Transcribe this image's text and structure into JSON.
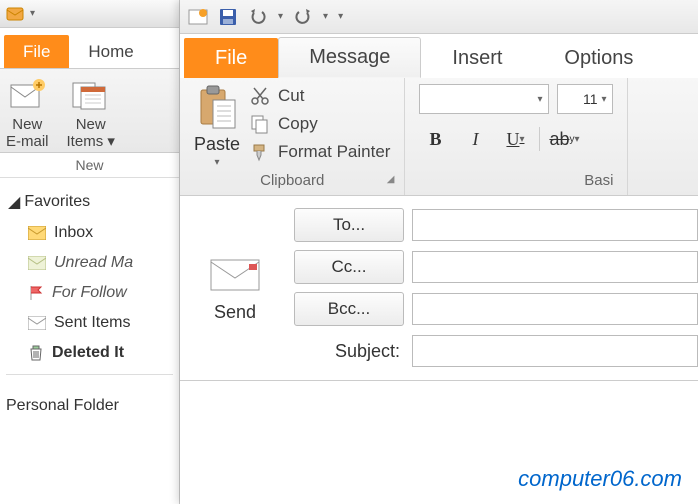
{
  "win1": {
    "tabs": {
      "file": "File",
      "home": "Home"
    },
    "ribbon": {
      "new_email": "New\nE-mail",
      "new_items": "New\nItems ▾",
      "group": "New"
    },
    "nav": {
      "favorites": "Favorites",
      "inbox": "Inbox",
      "unread": "Unread Ma",
      "follow": "For Follow",
      "sent": "Sent Items",
      "deleted": "Deleted It",
      "personal": "Personal Folder"
    }
  },
  "win2": {
    "tabs": {
      "file": "File",
      "message": "Message",
      "insert": "Insert",
      "options": "Options"
    },
    "clipboard": {
      "paste": "Paste",
      "cut": "Cut",
      "copy": "Copy",
      "painter": "Format Painter",
      "group": "Clipboard"
    },
    "font": {
      "size": "11",
      "group": "Basi"
    },
    "compose": {
      "send": "Send",
      "to": "To...",
      "cc": "Cc...",
      "bcc": "Bcc...",
      "subject": "Subject:"
    }
  },
  "watermark": "computer06.com"
}
